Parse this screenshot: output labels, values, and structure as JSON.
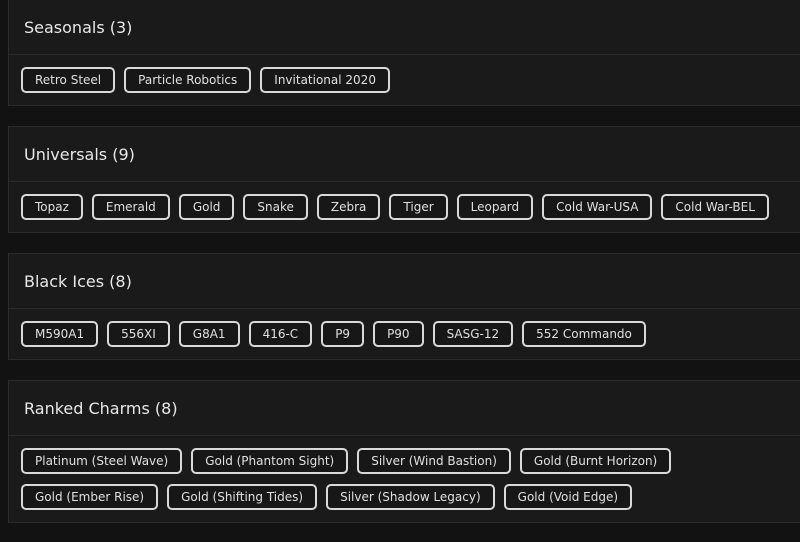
{
  "sections": [
    {
      "title": "Seasonals (3)",
      "tags": [
        "Retro Steel",
        "Particle Robotics",
        "Invitational 2020"
      ]
    },
    {
      "title": "Universals (9)",
      "tags": [
        "Topaz",
        "Emerald",
        "Gold",
        "Snake",
        "Zebra",
        "Tiger",
        "Leopard",
        "Cold War-USA",
        "Cold War-BEL"
      ]
    },
    {
      "title": "Black Ices (8)",
      "tags": [
        "M590A1",
        "556XI",
        "G8A1",
        "416-C",
        "P9",
        "P90",
        "SASG-12",
        "552 Commando"
      ]
    },
    {
      "title": "Ranked Charms (8)",
      "tags": [
        "Platinum (Steel Wave)",
        "Gold (Phantom Sight)",
        "Silver (Wind Bastion)",
        "Gold (Burnt Horizon)",
        "Gold (Ember Rise)",
        "Gold (Shifting Tides)",
        "Silver (Shadow Legacy)",
        "Gold (Void Edge)"
      ]
    }
  ]
}
